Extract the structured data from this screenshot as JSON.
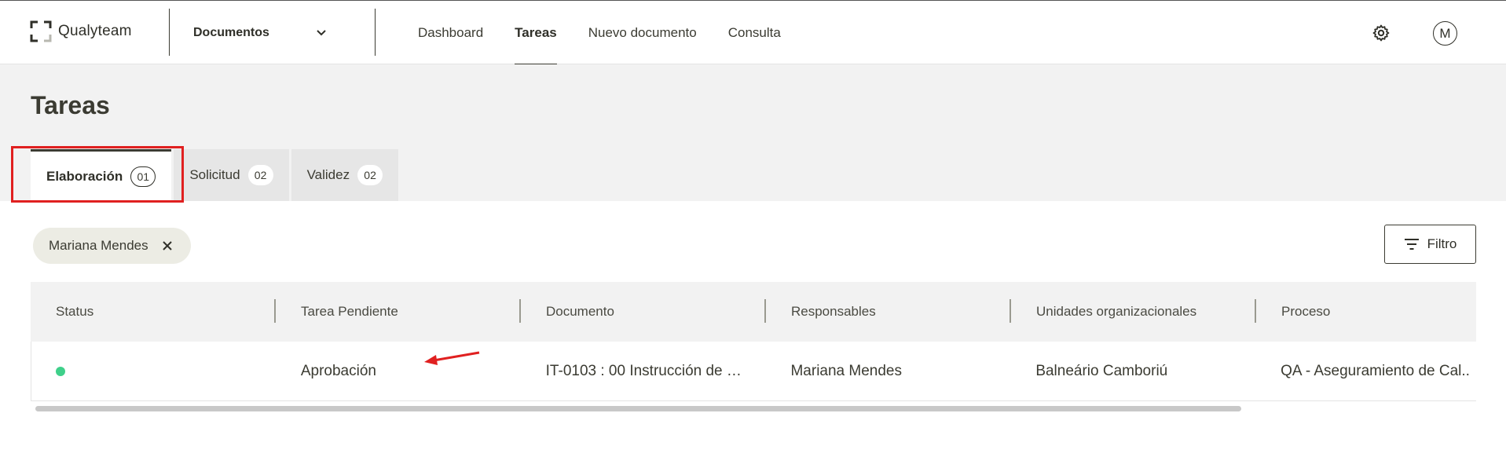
{
  "app": {
    "logo_text": "Qualyteam"
  },
  "module_selector": {
    "label": "Documentos"
  },
  "nav": {
    "items": [
      {
        "label": "Dashboard",
        "active": false
      },
      {
        "label": "Tareas",
        "active": true
      },
      {
        "label": "Nuevo documento",
        "active": false
      },
      {
        "label": "Consulta",
        "active": false
      }
    ]
  },
  "user": {
    "initial": "M"
  },
  "page": {
    "title": "Tareas"
  },
  "tabs": [
    {
      "label": "Elaboración",
      "count": "01",
      "active": true
    },
    {
      "label": "Solicitud",
      "count": "02",
      "active": false
    },
    {
      "label": "Validez",
      "count": "02",
      "active": false
    }
  ],
  "filter_chip": {
    "label": "Mariana Mendes"
  },
  "filter_button": {
    "label": "Filtro"
  },
  "table": {
    "columns": [
      "Status",
      "Tarea Pendiente",
      "Documento",
      "Responsables",
      "Unidades organizacionales",
      "Proceso"
    ],
    "rows": [
      {
        "status_color": "#3fd08a",
        "tarea": "Aprobación",
        "documento": "IT-0103 : 00 Instrucción de …",
        "responsables": "Mariana Mendes",
        "unidades": "Balneário Camboriú",
        "proceso": "QA - Aseguramiento de Cal.."
      }
    ]
  },
  "colors": {
    "highlight": "#e02020",
    "arrow": "#e02020",
    "text": "#3b3b32"
  }
}
